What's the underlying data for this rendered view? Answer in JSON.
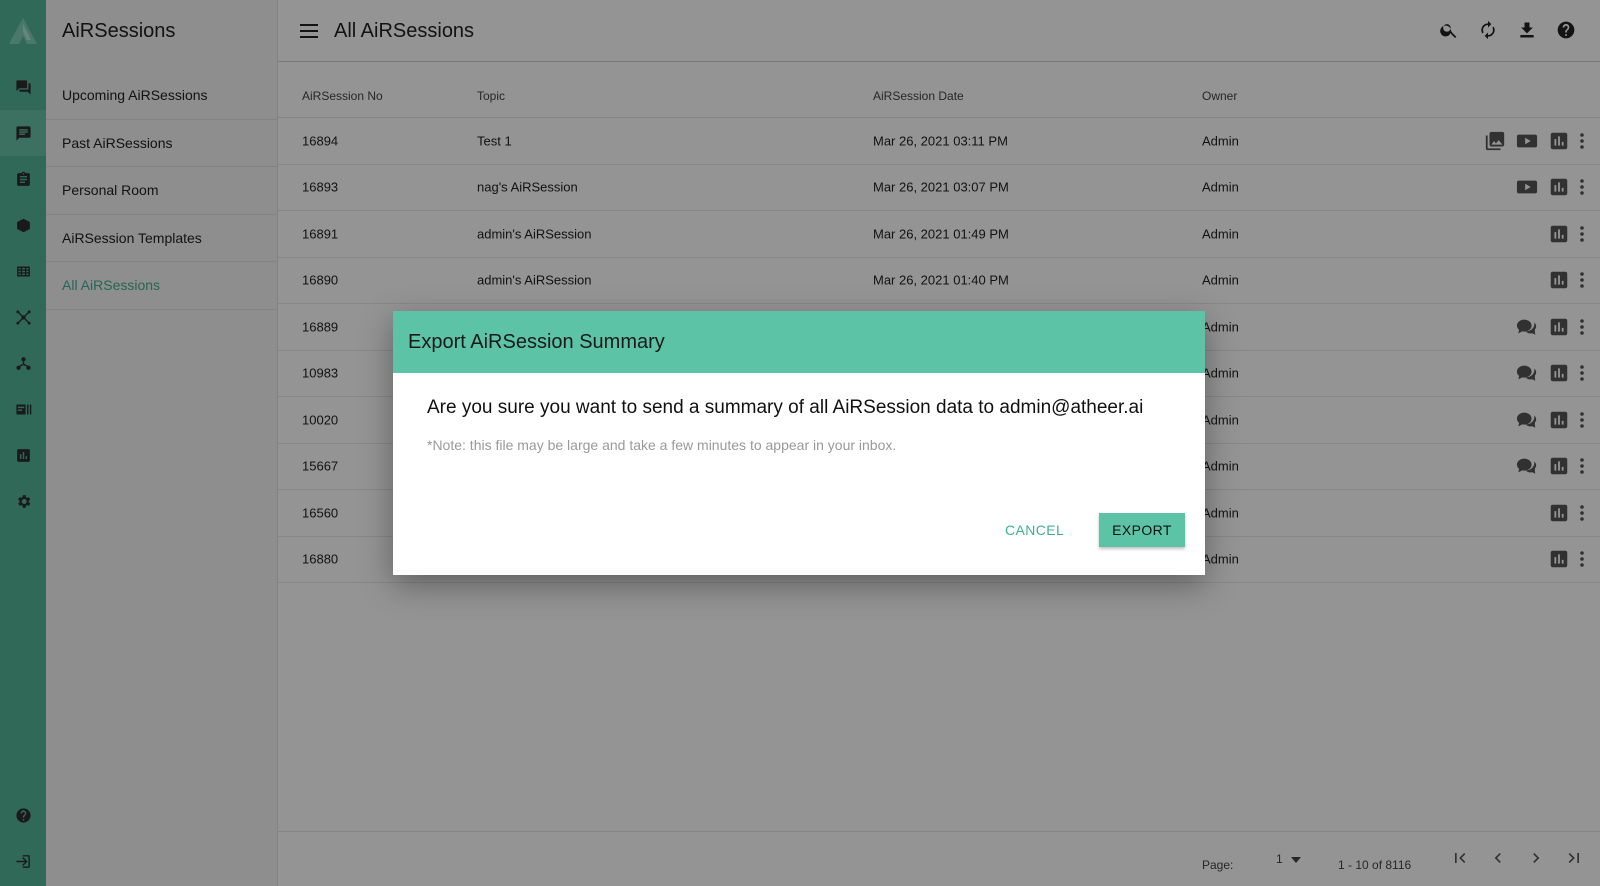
{
  "app": {
    "title": "AiRSessions"
  },
  "rail": {
    "icons": [
      "logo-icon",
      "chat-icon",
      "message-icon",
      "clipboard-icon",
      "book-icon",
      "grid-icon",
      "network-icon",
      "hierarchy-icon",
      "id-card-icon",
      "chart-icon",
      "gear-icon",
      "help-icon",
      "logout-icon"
    ],
    "active_index": 1
  },
  "nav": {
    "items": [
      {
        "label": "Upcoming AiRSessions",
        "active": false
      },
      {
        "label": "Past AiRSessions",
        "active": false
      },
      {
        "label": "Personal Room",
        "active": false
      },
      {
        "label": "AiRSession Templates",
        "active": false
      },
      {
        "label": "All AiRSessions",
        "active": true
      }
    ]
  },
  "header": {
    "title": "All AiRSessions",
    "icons": [
      "menu-icon",
      "search-icon",
      "refresh-icon",
      "download-icon",
      "help-icon"
    ]
  },
  "table": {
    "columns": [
      "AiRSession No",
      "Topic",
      "AiRSession Date",
      "Owner"
    ],
    "rows": [
      {
        "no": "16894",
        "topic": "Test 1",
        "date": "Mar 26, 2021 03:11 PM",
        "owner": "Admin",
        "actions": [
          "gallery-icon",
          "video-icon",
          "chart-icon"
        ]
      },
      {
        "no": "16893",
        "topic": "nag's AiRSession",
        "date": "Mar 26, 2021 03:07 PM",
        "owner": "Admin",
        "actions": [
          "video-icon",
          "chart-icon"
        ]
      },
      {
        "no": "16891",
        "topic": "admin's AiRSession",
        "date": "Mar 26, 2021 01:49 PM",
        "owner": "Admin",
        "actions": [
          "chart-icon"
        ]
      },
      {
        "no": "16890",
        "topic": "admin's AiRSession",
        "date": "Mar 26, 2021 01:40 PM",
        "owner": "Admin",
        "actions": [
          "chart-icon"
        ]
      },
      {
        "no": "16889",
        "topic": "",
        "date": "",
        "owner": "Admin",
        "actions": [
          "comments-icon",
          "chart-icon"
        ]
      },
      {
        "no": "10983",
        "topic": "",
        "date": "",
        "owner": "Admin",
        "actions": [
          "comments-icon",
          "chart-icon"
        ]
      },
      {
        "no": "10020",
        "topic": "",
        "date": "",
        "owner": "Admin",
        "actions": [
          "comments-icon",
          "chart-icon"
        ]
      },
      {
        "no": "15667",
        "topic": "",
        "date": "",
        "owner": "Admin",
        "actions": [
          "comments-icon",
          "chart-icon"
        ]
      },
      {
        "no": "16560",
        "topic": "",
        "date": "",
        "owner": "Admin",
        "actions": [
          "chart-icon"
        ]
      },
      {
        "no": "16880",
        "topic": "",
        "date": "",
        "owner": "Admin",
        "actions": [
          "chart-icon"
        ]
      }
    ]
  },
  "pagination": {
    "page_label": "Page:",
    "page_value": "1",
    "range": "1 - 10 of 8116",
    "icons": [
      "first-page-icon",
      "prev-page-icon",
      "next-page-icon",
      "last-page-icon"
    ]
  },
  "dialog": {
    "title": "Export AiRSession Summary",
    "message": "Are you sure you want to send a summary of all AiRSession data to admin@atheer.ai",
    "note": "*Note: this file may be large and take a few minutes to appear in your inbox.",
    "cancel_label": "CANCEL",
    "export_label": "EXPORT"
  },
  "colors": {
    "accent": "#5dc3a7",
    "rail": "#55b699",
    "active_text": "#3fb18e"
  }
}
